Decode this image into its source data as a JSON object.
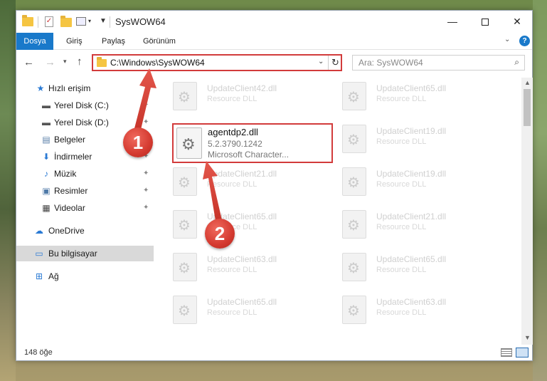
{
  "window": {
    "title": "SysWOW64"
  },
  "ribbon": {
    "tabs": [
      "Dosya",
      "Giriş",
      "Paylaş",
      "Görünüm"
    ],
    "help_label": "?"
  },
  "window_controls": {
    "minimize": "—",
    "close": "✕"
  },
  "address_bar": {
    "path": "C:\\Windows\\SysWOW64",
    "refresh_glyph": "↻"
  },
  "search": {
    "placeholder": "Ara: SysWOW64"
  },
  "sidebar": {
    "items": [
      {
        "label": "Hızlı erişim",
        "icon": "star-icon"
      },
      {
        "label": "Yerel Disk (C:)",
        "icon": "drive-icon"
      },
      {
        "label": "Yerel Disk (D:)",
        "icon": "drive-icon"
      },
      {
        "label": "Belgeler",
        "icon": "documents-icon"
      },
      {
        "label": "İndirmeler",
        "icon": "download-icon"
      },
      {
        "label": "Müzik",
        "icon": "music-icon"
      },
      {
        "label": "Resimler",
        "icon": "pictures-icon"
      },
      {
        "label": "Videolar",
        "icon": "videos-icon"
      },
      {
        "label": "OneDrive",
        "icon": "cloud-icon"
      },
      {
        "label": "Bu bilgisayar",
        "icon": "computer-icon"
      },
      {
        "label": "Ağ",
        "icon": "network-icon"
      }
    ]
  },
  "files": {
    "highlighted": {
      "name": "agentdp2.dll",
      "version": "5.2.3790.1242",
      "description": "Microsoft Character..."
    },
    "left_column": [
      {
        "name": "UpdateClient42.dll",
        "type": "Resource DLL"
      },
      {
        "name": "UpdateClient21.dll",
        "type": "Resource DLL"
      },
      {
        "name": "UpdateClient65.dll",
        "type": "Resource DLL"
      },
      {
        "name": "UpdateClient63.dll",
        "type": "Resource DLL"
      },
      {
        "name": "UpdateClient65.dll",
        "type": "Resource DLL"
      }
    ],
    "right_column": [
      {
        "name": "UpdateClient65.dll",
        "type": "Resource DLL"
      },
      {
        "name": "UpdateClient19.dll",
        "type": "Resource DLL"
      },
      {
        "name": "UpdateClient19.dll",
        "type": "Resource DLL"
      },
      {
        "name": "UpdateClient21.dll",
        "type": "Resource DLL"
      },
      {
        "name": "UpdateClient65.dll",
        "type": "Resource DLL"
      },
      {
        "name": "UpdateClient63.dll",
        "type": "Resource DLL"
      }
    ]
  },
  "status": {
    "item_count": "148 öğe"
  },
  "annotations": {
    "step1": "1",
    "step2": "2",
    "color": "#d23b3b"
  }
}
